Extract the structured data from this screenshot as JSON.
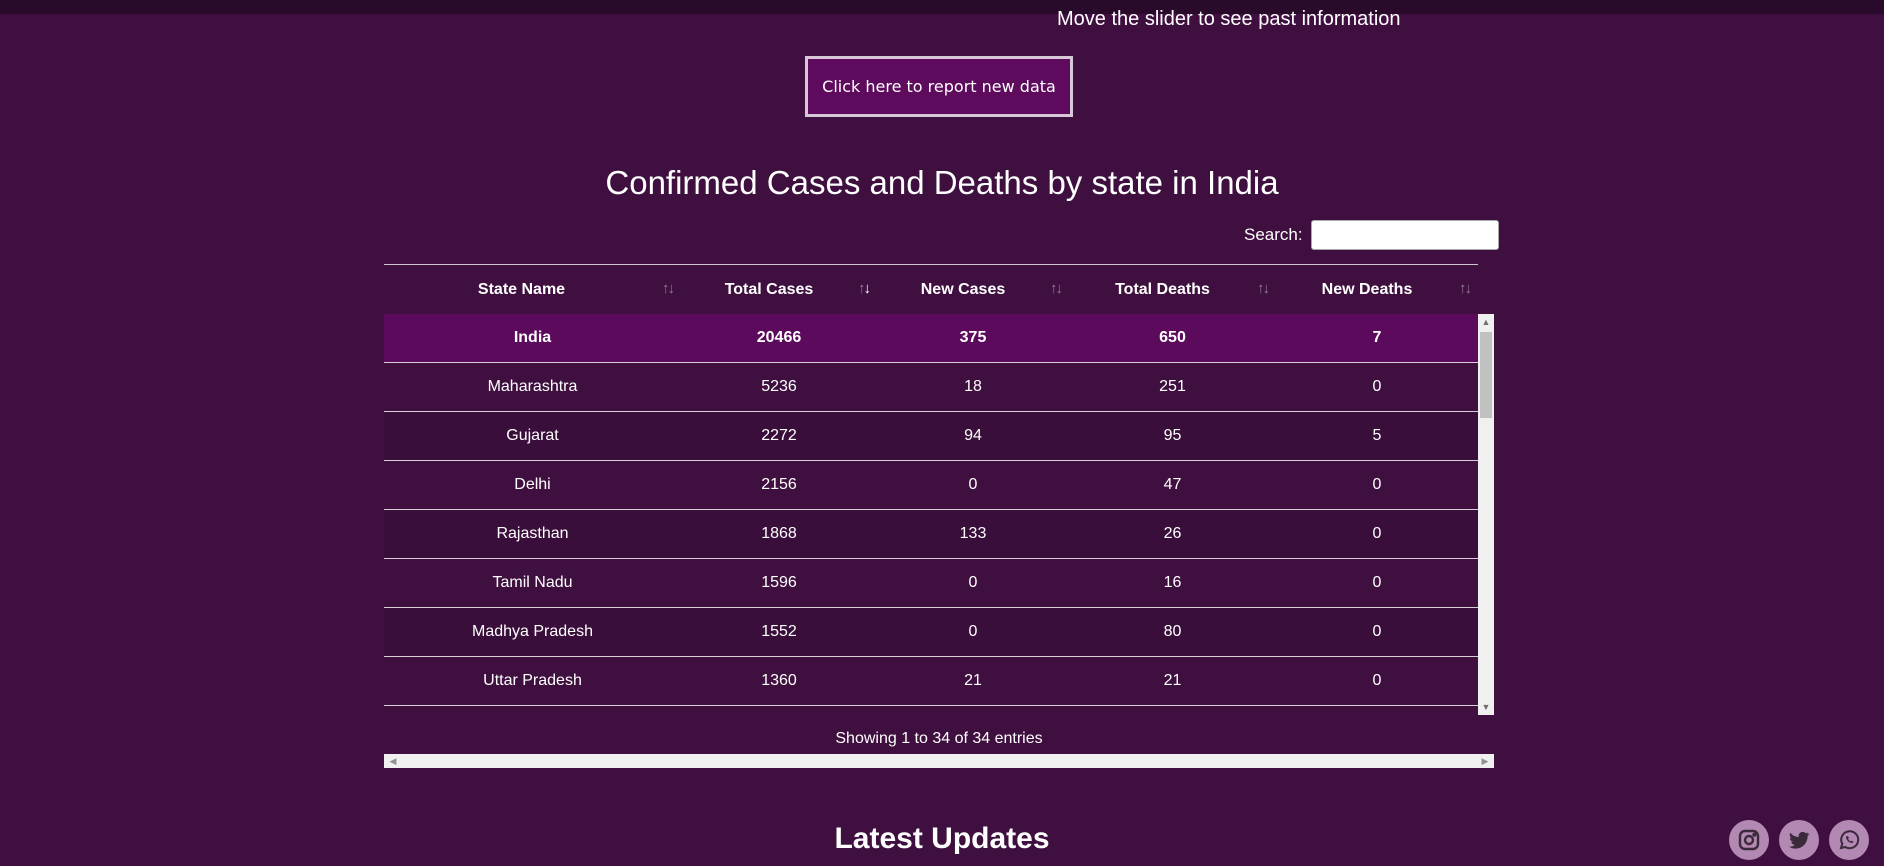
{
  "header": {
    "slider_hint": "Move the slider to see past information",
    "report_button": "Click here to report new data"
  },
  "title": "Confirmed Cases and Deaths by state in India",
  "search": {
    "label": "Search:",
    "value": "",
    "placeholder": ""
  },
  "table": {
    "columns": [
      "State Name",
      "Total Cases",
      "New Cases",
      "Total Deaths",
      "New Deaths"
    ],
    "sorted_column": "Total Cases",
    "sort_direction": "descending",
    "total_row": {
      "state": "India",
      "total_cases": "20466",
      "new_cases": "375",
      "total_deaths": "650",
      "new_deaths": "7"
    },
    "rows": [
      {
        "state": "Maharashtra",
        "total_cases": "5236",
        "new_cases": "18",
        "total_deaths": "251",
        "new_deaths": "0"
      },
      {
        "state": "Gujarat",
        "total_cases": "2272",
        "new_cases": "94",
        "total_deaths": "95",
        "new_deaths": "5"
      },
      {
        "state": "Delhi",
        "total_cases": "2156",
        "new_cases": "0",
        "total_deaths": "47",
        "new_deaths": "0"
      },
      {
        "state": "Rajasthan",
        "total_cases": "1868",
        "new_cases": "133",
        "total_deaths": "26",
        "new_deaths": "0"
      },
      {
        "state": "Tamil Nadu",
        "total_cases": "1596",
        "new_cases": "0",
        "total_deaths": "16",
        "new_deaths": "0"
      },
      {
        "state": "Madhya Pradesh",
        "total_cases": "1552",
        "new_cases": "0",
        "total_deaths": "80",
        "new_deaths": "0"
      },
      {
        "state": "Uttar Pradesh",
        "total_cases": "1360",
        "new_cases": "21",
        "total_deaths": "21",
        "new_deaths": "0"
      }
    ],
    "info": "Showing 1 to 34 of 34 entries"
  },
  "updates_heading": "Latest Updates",
  "social": [
    {
      "name": "instagram-icon"
    },
    {
      "name": "twitter-icon"
    },
    {
      "name": "whatsapp-icon"
    }
  ],
  "colors": {
    "background": "#3f103f",
    "button_bg": "#5e0b5e",
    "total_row_bg": "#5c0b5c",
    "social_bg": "#b388b3"
  }
}
